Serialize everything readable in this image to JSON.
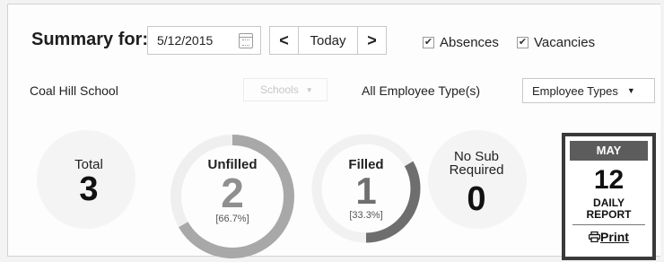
{
  "summary": {
    "label": "Summary for:",
    "date_value": "5/12/2015",
    "prev_label": "<",
    "today_label": "Today",
    "next_label": ">",
    "absences_label": "Absences",
    "absences_checked": true,
    "vacancies_label": "Vacancies",
    "vacancies_checked": true,
    "check_mark": "✔"
  },
  "filters": {
    "school_name": "Coal Hill School",
    "schools_select": "Schools",
    "employee_type_label": "All Employee Type(s)",
    "employee_types_select": "Employee Types"
  },
  "stats": {
    "total": {
      "label": "Total",
      "value": "3"
    },
    "unfilled": {
      "label": "Unfilled",
      "value": "2",
      "percent": "[66.7%]",
      "fraction": 0.667
    },
    "filled": {
      "label": "Filled",
      "value": "1",
      "percent": "[33.3%]",
      "fraction": 0.333
    },
    "no_sub": {
      "label_line1": "No Sub",
      "label_line2": "Required",
      "value": "0"
    }
  },
  "daily_report": {
    "month": "MAY",
    "day": "12",
    "line1": "DAILY",
    "line2": "REPORT",
    "print_label": "Print",
    "print_icon": "printer-icon"
  },
  "colors": {
    "unfilled_ring": "#a8a8a8",
    "filled_ring": "#6e6e6e",
    "ghost_circle": "#f4f4f4"
  }
}
